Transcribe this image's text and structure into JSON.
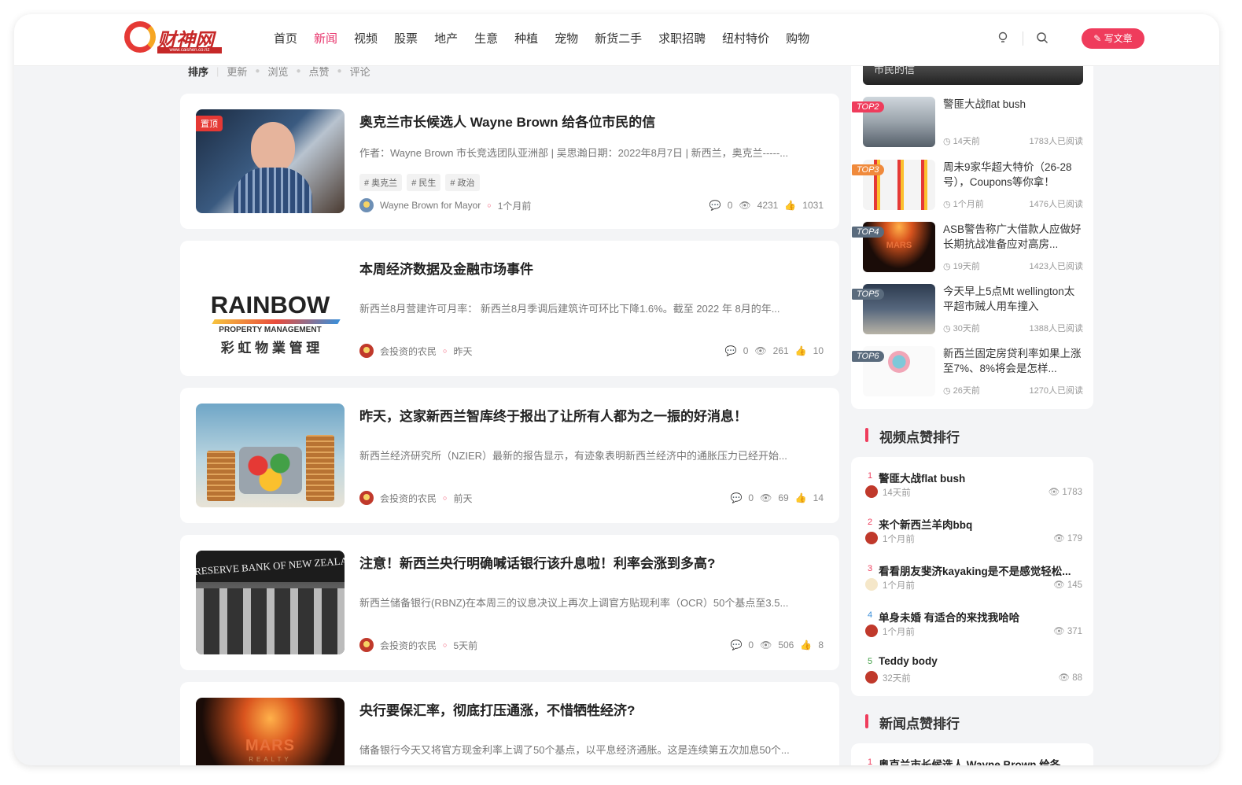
{
  "logo": {
    "text": "财神网",
    "sub": "www.caishen.co.nz"
  },
  "nav": [
    "首页",
    "新闻",
    "视频",
    "股票",
    "地产",
    "生意",
    "种植",
    "宠物",
    "新货二手",
    "求职招聘",
    "纽村特价",
    "购物"
  ],
  "nav_active_index": 1,
  "header": {
    "write_label": "✎ 写文章"
  },
  "sort": {
    "label": "排序",
    "options": [
      "更新",
      "浏览",
      "点赞",
      "评论"
    ]
  },
  "articles": [
    {
      "pin": "置顶",
      "title": "奥克兰市长候选人 Wayne Brown 给各位市民的信",
      "excerpt": "作者：Wayne Brown 市长竞选团队亚洲部 | 吴思瀚日期：2022年8月7日 | 新西兰，奥克兰-----...",
      "tags": [
        "# 奥克兰",
        "# 民生",
        "# 政治"
      ],
      "author": "Wayne Brown for Mayor",
      "time": "1个月前",
      "comments": "0",
      "views": "4231",
      "likes": "1031"
    },
    {
      "title": "本周经济数据及金融市场事件",
      "excerpt": "新西兰8月营建许可月率：  新西兰8月季调后建筑许可环比下降1.6%。截至 2022 年 8月的年...",
      "thumb_text": {
        "line1": "RAINBOW",
        "line2": "PROPERTY MANAGEMENT",
        "line3": "彩 虹 物 業 管 理"
      },
      "author": "会投资的农民",
      "time": "昨天",
      "comments": "0",
      "views": "261",
      "likes": "10"
    },
    {
      "title": "昨天，这家新西兰智库终于报出了让所有人都为之一振的好消息！",
      "excerpt": "新西兰经济研究所（NZIER）最新的报告显示，有迹象表明新西兰经济中的通胀压力已经开始...",
      "author": "会投资的农民",
      "time": "前天",
      "comments": "0",
      "views": "69",
      "likes": "14"
    },
    {
      "title": "注意！新西兰央行明确喊话银行该升息啦！利率会涨到多高?",
      "excerpt": "新西兰储备银行(RBNZ)在本周三的议息决议上再次上调官方贴现利率（OCR）50个基点至3.5...",
      "thumb_text": {
        "line1": "RESERVE BANK OF NEW ZEALAND"
      },
      "author": "会投资的农民",
      "time": "5天前",
      "comments": "0",
      "views": "506",
      "likes": "8"
    },
    {
      "title": "央行要保汇率，彻底打压通涨，不惜牺牲经济?",
      "excerpt": "储备银行今天又将官方现金利率上调了50个基点，以平息经济通胀。这是连续第五次加息50个...",
      "thumb_text": {
        "line1": "MARS",
        "line2": "REALTY"
      }
    }
  ],
  "hot": {
    "top_partial": "市民的信",
    "items": [
      {
        "badge": "TOP2",
        "title": "警匪大战flat bush",
        "time": "14天前",
        "reads": "1783人已阅读"
      },
      {
        "badge": "TOP3",
        "title": "周未9家华超大特价（26-28号），Coupons等你拿！",
        "time": "1个月前",
        "reads": "1476人已阅读"
      },
      {
        "badge": "TOP4",
        "title": "ASB警告称广大借款人应做好长期抗战准备应对高房...",
        "time": "19天前",
        "reads": "1423人已阅读",
        "thumb_text": "MARS"
      },
      {
        "badge": "TOP5",
        "title": "今天早上5点Mt wellington太平超市贼人用车撞入",
        "time": "30天前",
        "reads": "1388人已阅读"
      },
      {
        "badge": "TOP6",
        "title": "新西兰固定房贷利率如果上涨至7%、8%将会是怎样...",
        "time": "26天前",
        "reads": "1270人已阅读"
      }
    ]
  },
  "video_rank": {
    "title": "视频点赞排行",
    "items": [
      {
        "num": "1",
        "title": "警匪大战flat bush",
        "time": "14天前",
        "views": "1783"
      },
      {
        "num": "2",
        "title": "来个新西兰羊肉bbq",
        "time": "1个月前",
        "views": "179"
      },
      {
        "num": "3",
        "title": "看看朋友斐济kayaking是不是感觉轻松...",
        "time": "1个月前",
        "views": "145"
      },
      {
        "num": "4",
        "title": "单身未婚 有适合的来找我哈哈",
        "time": "1个月前",
        "views": "371"
      },
      {
        "num": "5",
        "title": "Teddy body",
        "time": "32天前",
        "views": "88"
      }
    ]
  },
  "news_rank": {
    "title": "新闻点赞排行",
    "items": [
      {
        "num": "1",
        "title": "奥克兰市长候选人 Wayne Brown 给各..."
      }
    ]
  },
  "colors": {
    "accent": "#ef3c5c",
    "nav_active": "#e8366d"
  }
}
